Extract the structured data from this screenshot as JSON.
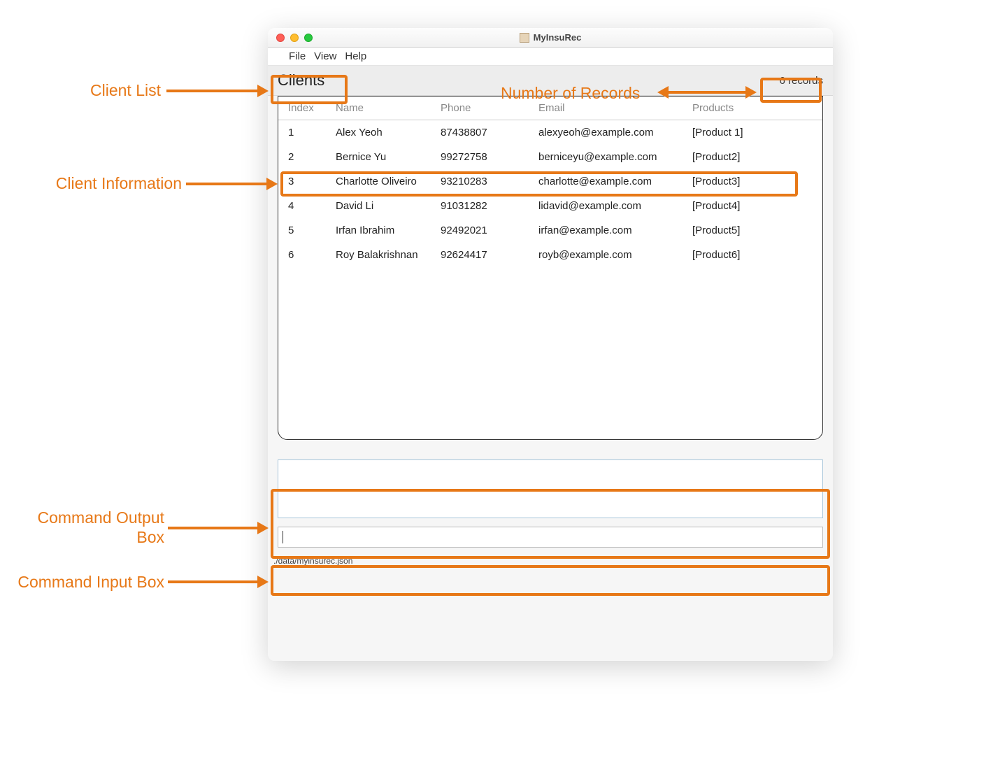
{
  "window": {
    "title": "MyInsuRec"
  },
  "menubar": {
    "file": "File",
    "view": "View",
    "help": "Help"
  },
  "panel": {
    "title": "Clients",
    "records": "6 records"
  },
  "columns": {
    "index": "Index",
    "name": "Name",
    "phone": "Phone",
    "email": "Email",
    "products": "Products"
  },
  "rows": [
    {
      "index": "1",
      "name": "Alex Yeoh",
      "phone": "87438807",
      "email": "alexyeoh@example.com",
      "products": "[Product 1]"
    },
    {
      "index": "2",
      "name": "Bernice Yu",
      "phone": "99272758",
      "email": "berniceyu@example.com",
      "products": "[Product2]"
    },
    {
      "index": "3",
      "name": "Charlotte Oliveiro",
      "phone": "93210283",
      "email": "charlotte@example.com",
      "products": "[Product3]"
    },
    {
      "index": "4",
      "name": "David Li",
      "phone": "91031282",
      "email": "lidavid@example.com",
      "products": "[Product4]"
    },
    {
      "index": "5",
      "name": "Irfan Ibrahim",
      "phone": "92492021",
      "email": "irfan@example.com",
      "products": "[Product5]"
    },
    {
      "index": "6",
      "name": "Roy Balakrishnan",
      "phone": "92624417",
      "email": "royb@example.com",
      "products": "[Product6]"
    }
  ],
  "statusbar": {
    "path": "./data/myinsurec.json"
  },
  "callouts": {
    "clientList": "Client List",
    "numberOfRecords": "Number of Records",
    "clientInformation": "Client Information",
    "commandOutputBox": "Command Output\nBox",
    "commandInputBox": "Command Input Box"
  }
}
